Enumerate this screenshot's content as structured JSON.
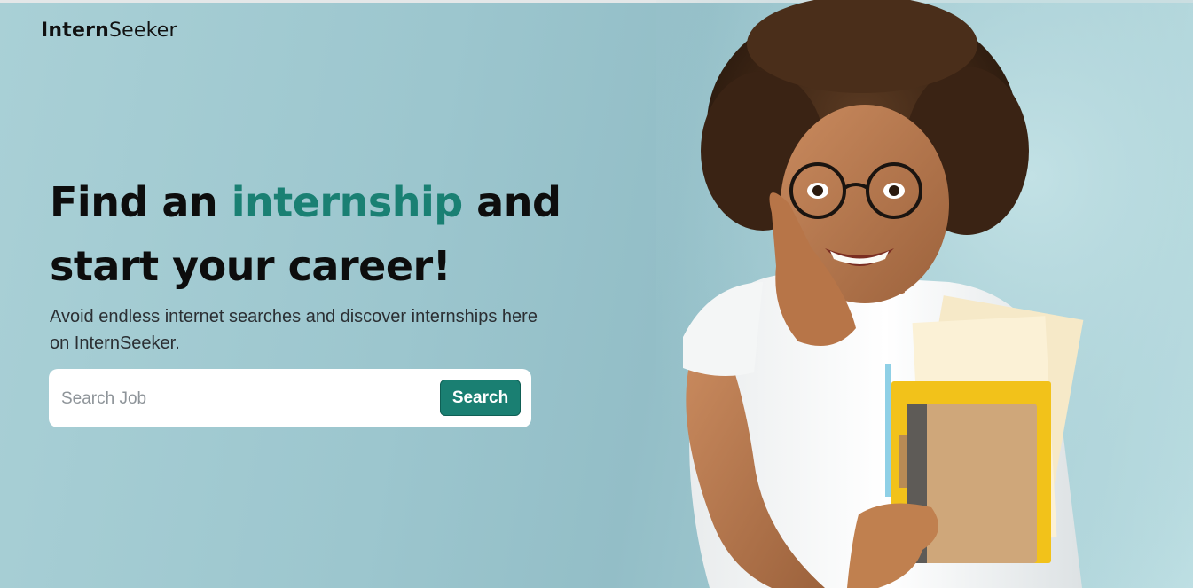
{
  "brand": {
    "bold": "Intern",
    "light": "Seeker"
  },
  "hero": {
    "headline_part1": "Find an ",
    "headline_accent": "internship",
    "headline_part2": " and start your career!",
    "subtitle": "Avoid endless internet searches and discover internships here on InternSeeker."
  },
  "search": {
    "placeholder": "Search Job",
    "value": "",
    "button_label": "Search"
  },
  "colors": {
    "accent": "#1a8073",
    "button": "#1a7f72",
    "background": "#a6cdd4"
  }
}
